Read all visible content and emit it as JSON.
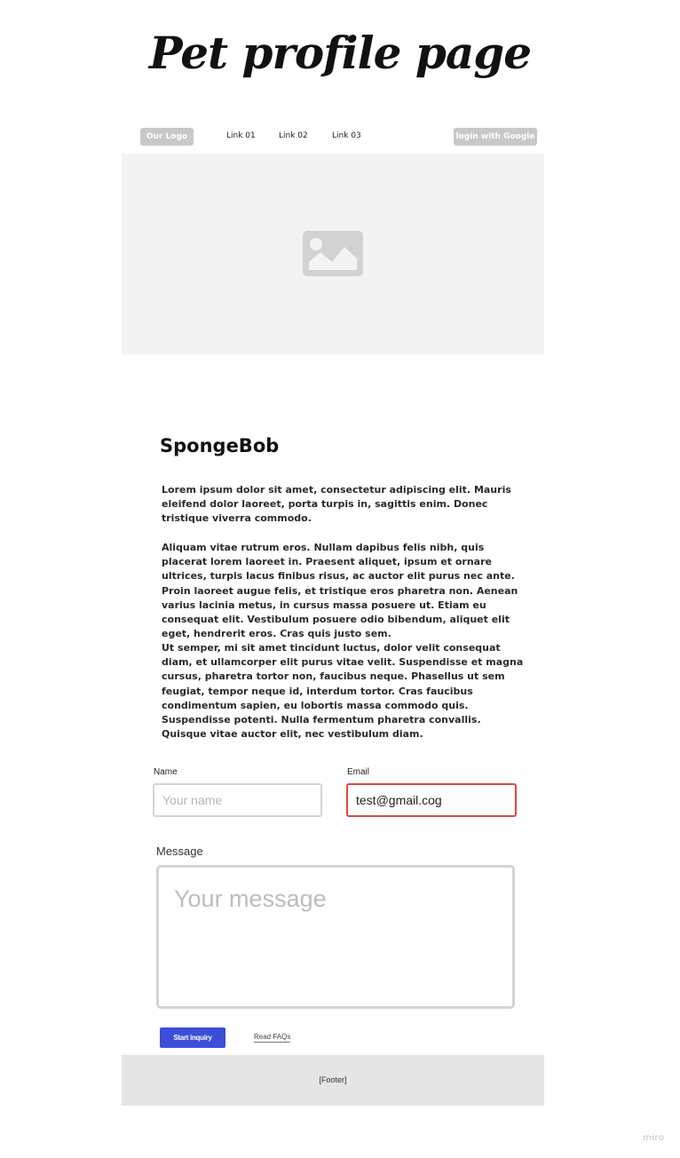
{
  "page": {
    "title": "Pet profile page"
  },
  "navbar": {
    "logo": "Our Logo",
    "links": [
      "Link 01",
      "Link 02",
      "Link 03"
    ],
    "login": "login with Google"
  },
  "hero": {
    "icon": "image-placeholder-icon"
  },
  "pet": {
    "name": "SpongeBob",
    "paragraphs": [
      "Lorem ipsum dolor sit amet, consectetur adipiscing elit. Mauris eleifend dolor laoreet, porta turpis in, sagittis enim. Donec tristique viverra commodo.",
      "Aliquam vitae rutrum eros. Nullam dapibus felis nibh, quis placerat lorem laoreet in. Praesent aliquet, ipsum et ornare ultrices, turpis lacus finibus risus, ac auctor elit purus nec ante. Proin laoreet augue felis, et tristique eros pharetra non. Aenean varius lacinia metus, in cursus massa posuere ut. Etiam eu consequat elit. Vestibulum posuere odio bibendum, aliquet elit eget, hendrerit eros. Cras quis justo sem.",
      "Ut semper, mi sit amet tincidunt luctus, dolor velit consequat diam, et ullamcorper elit purus vitae velit. Suspendisse et magna cursus, pharetra tortor non, faucibus neque. Phasellus ut sem feugiat, tempor neque id, interdum tortor. Cras faucibus condimentum sapien, eu lobortis massa commodo quis. Suspendisse potenti. Nulla fermentum pharetra convallis. Quisque vitae auctor elit, nec vestibulum diam."
    ]
  },
  "form": {
    "name_label": "Name",
    "name_placeholder": "Your name",
    "name_value": "",
    "email_label": "Email",
    "email_value": "test@gmail.cog",
    "email_error_color": "#d94b3a",
    "message_label": "Message",
    "message_placeholder": "Your message",
    "submit_label": "Start inquiry",
    "submit_color": "#3b4fd8",
    "faq_label": "Read FAQs"
  },
  "footer": {
    "text": "[Footer]"
  },
  "watermark": "miro"
}
